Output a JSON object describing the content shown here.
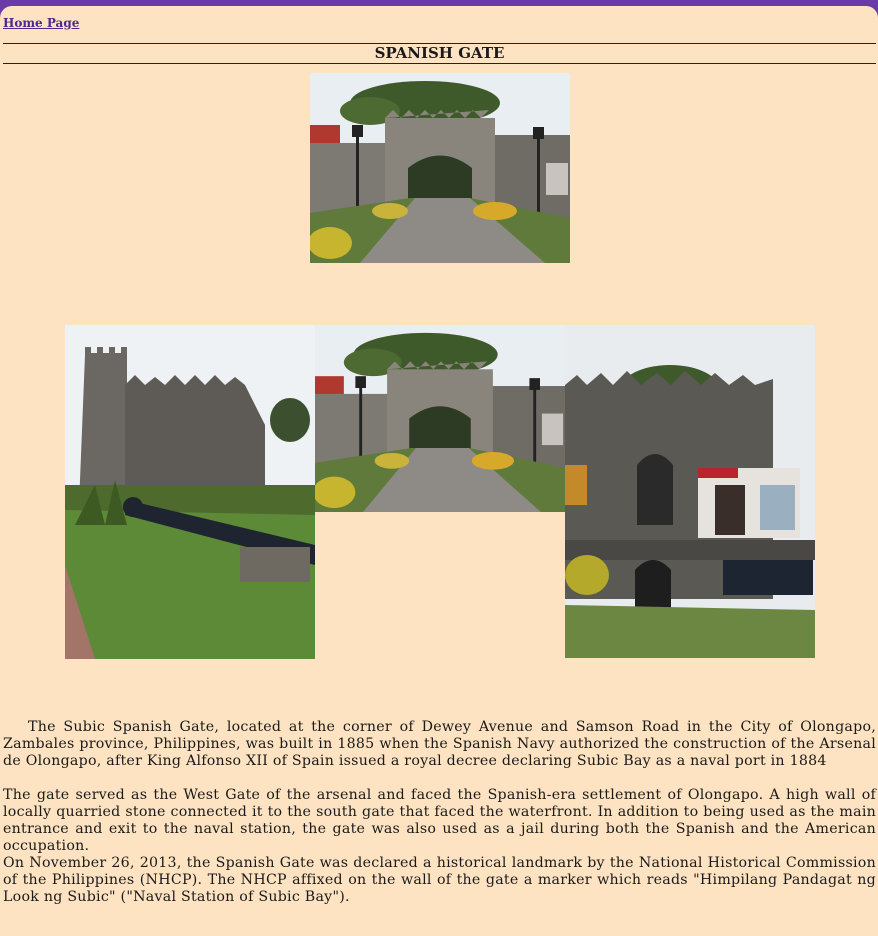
{
  "nav": {
    "home_label": "Home Page"
  },
  "page": {
    "title": "SPANISH GATE"
  },
  "photos": [
    {
      "name": "spanish-gate-photo-top",
      "subject": "spanish-gate-arch"
    },
    {
      "name": "ruins-cannon-photo",
      "subject": "ruined-tower-with-cannon"
    },
    {
      "name": "spanish-gate-photo-middle",
      "subject": "spanish-gate-arch"
    },
    {
      "name": "wall-with-marker-photo",
      "subject": "crenellated-wall-with-poster"
    }
  ],
  "content": {
    "paragraph_1": "The Subic Spanish Gate, located at the corner of Dewey Avenue and Samson Road in the City of Olongapo, Zambales province, Philippines, was built in 1885 when the Spanish Navy authorized the construction of the Arsenal de Olongapo, after King Alfonso XII of Spain issued a royal decree declaring Subic Bay as a naval port in 1884",
    "paragraph_2": "The gate served as the West Gate of the arsenal and faced the Spanish-era settlement of Olongapo. A high wall of locally quarried stone connected it to the south gate that faced the waterfront. In addition to being used as the main entrance and exit to the naval station, the gate was also used as a jail during both the Spanish and the American occupation.",
    "paragraph_3": "On November 26, 2013, the Spanish Gate was declared a historical landmark by the National Historical Commission of the Philippines (NHCP). The NHCP affixed on the wall of the gate a marker which reads \"Himpilang Pandagat ng Look ng Subic\" (\"Naval Station of Subic Bay\")."
  }
}
